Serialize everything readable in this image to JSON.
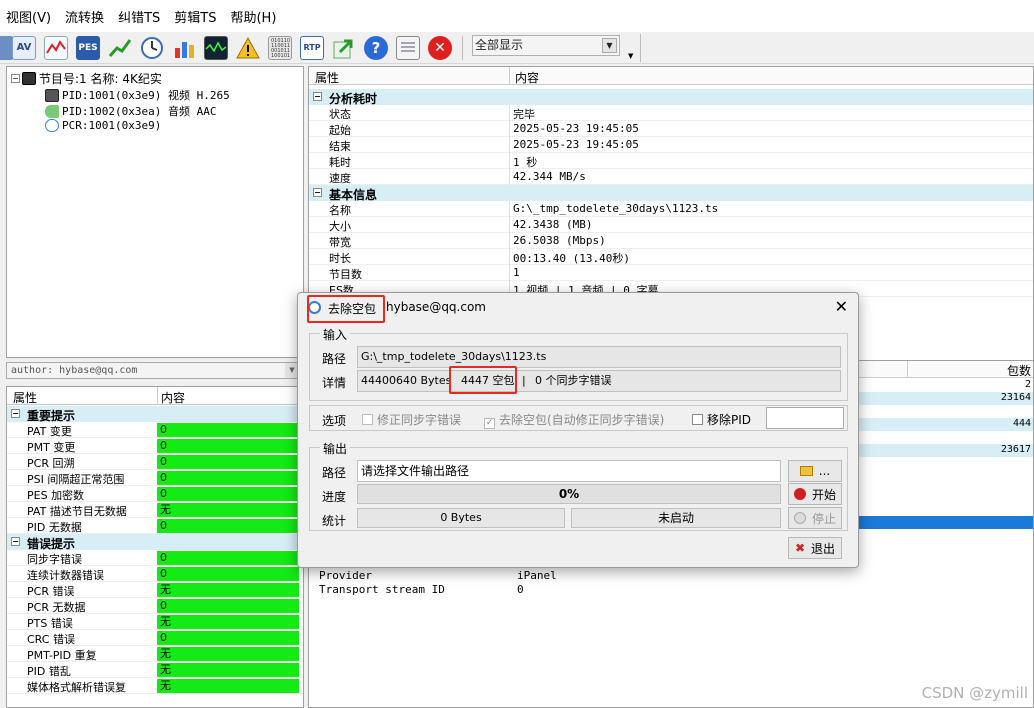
{
  "menu": [
    "视图(V)",
    "流转换",
    "纠错TS",
    "剪辑TS",
    "帮助(H)"
  ],
  "toolbar": {
    "filter_value": "全部显示",
    "icons": [
      "av-icon",
      "wave-icon",
      "pes-icon",
      "chart-up-icon",
      "clock-icon",
      "bar-chart-icon",
      "spectrum-icon",
      "warning-icon",
      "binary-icon",
      "rtp-icon",
      "export-arrow-icon",
      "help-icon",
      "notes-icon",
      "close-icon"
    ]
  },
  "tree": {
    "root": "节目号:1 名称: 4K纪实",
    "children": [
      "PID:1001(0x3e9) 视频 H.265",
      "PID:1002(0x3ea) 音频 AAC",
      "PCR:1001(0x3e9)"
    ]
  },
  "author_box": "author: hybase@qq.com",
  "left_table": {
    "col_attr": "属性",
    "col_val": "内容",
    "sec1": "重要提示",
    "rows1": [
      [
        "PAT 变更",
        "0"
      ],
      [
        "PMT 变更",
        "0"
      ],
      [
        "PCR 回溯",
        "0"
      ],
      [
        "PSI 间隔超正常范围",
        "0"
      ],
      [
        "PES 加密数",
        "0"
      ],
      [
        "PAT 描述节目无数据",
        "无"
      ],
      [
        "PID 无数据",
        "0"
      ]
    ],
    "sec2": "错误提示",
    "rows2": [
      [
        "同步字错误",
        "0"
      ],
      [
        "连续计数器错误",
        "0"
      ],
      [
        "PCR 错误",
        "无"
      ],
      [
        "PCR 无数据",
        "0"
      ],
      [
        "PTS 错误",
        "无"
      ],
      [
        "CRC 错误",
        "0"
      ],
      [
        "PMT-PID 重复",
        "无"
      ],
      [
        "PID 错乱",
        "无"
      ],
      [
        "媒体格式解析错误复",
        "无"
      ]
    ]
  },
  "right_table": {
    "col_attr": "属性",
    "col_val": "内容",
    "sec1": "分析耗时",
    "rows1": [
      [
        "状态",
        "完毕"
      ],
      [
        "起始",
        "2025-05-23 19:45:05"
      ],
      [
        "结束",
        "2025-05-23 19:45:05"
      ],
      [
        "耗时",
        "1 秒"
      ],
      [
        "速度",
        "42.344 MB/s"
      ]
    ],
    "sec2": "基本信息",
    "rows2": [
      [
        "名称",
        "G:\\_tmp_todelete_30days\\1123.ts"
      ],
      [
        "大小",
        "42.3438 (MB)"
      ],
      [
        "带宽",
        "26.5038 (Mbps)"
      ],
      [
        "时长",
        "00:13.40 (13.40秒)"
      ],
      [
        "节目数",
        "1"
      ],
      [
        "ES数",
        "1 视频 | 1 音频 | 0 字幕"
      ]
    ]
  },
  "right_bottom": {
    "col_packets": "包数",
    "packet_values": [
      "2",
      "23164",
      "",
      "444",
      "",
      "23617"
    ],
    "rows": [
      [
        "Provider",
        "iPanel"
      ],
      [
        "Transport stream ID",
        "0"
      ]
    ]
  },
  "dialog": {
    "title": "去除空包",
    "title_suffix": "hybase@qq.com",
    "close": "✕",
    "input_group": "输入",
    "path_label": "路径",
    "path_value": "G:\\_tmp_todelete_30days\\1123.ts",
    "detail_label": "详情",
    "bytes": "44400640 Bytes",
    "null_packets": "4447 空包",
    "sep": "|",
    "sync_errors": "0 个同步字错误",
    "options_label": "选项",
    "opt1": "修正同步字错误",
    "opt2": "去除空包(自动修正同步字错误)",
    "opt3": "移除PID",
    "output_group": "输出",
    "out_path_label": "路径",
    "out_path_value": "请选择文件输出路径",
    "browse": "...",
    "progress_label": "进度",
    "progress_text": "0%",
    "progress": 0,
    "start": "开始",
    "stats_label": "统计",
    "stats_bytes": "0 Bytes",
    "stats_status": "未启动",
    "stop": "停止",
    "exit": "退出"
  },
  "watermark": "CSDN @zymill"
}
